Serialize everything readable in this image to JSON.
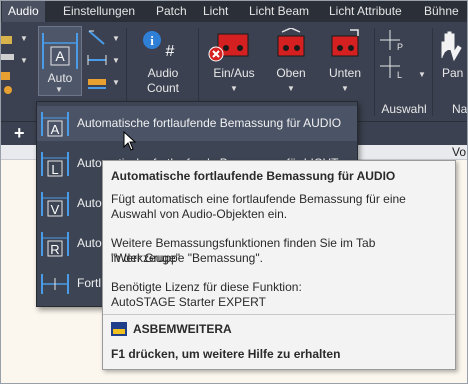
{
  "tabs": [
    "Audio",
    "Einstellungen",
    "Patch",
    "Licht",
    "Licht Beam",
    "Licht Attribute",
    "Bühne"
  ],
  "ribbon": {
    "auto_label": "Auto",
    "audio_count_label_1": "Audio",
    "audio_count_label_2": "Count",
    "ein_aus_label": "Ein/Aus",
    "oben_label": "Oben",
    "unten_label": "Unten",
    "auswahl_label": "Auswahl",
    "pan_label": "Pan",
    "extra_label": "Na"
  },
  "doc": {
    "plus": "+",
    "right_text": "Vo"
  },
  "dropdown": {
    "items": [
      {
        "letter": "A",
        "label": "Automatische fortlaufende Bemassung für AUDIO"
      },
      {
        "letter": "L",
        "label": "Automatische fortlaufende Bemassung für LICHT"
      },
      {
        "letter": "V",
        "label": "Auto"
      },
      {
        "letter": "R",
        "label": "Auto"
      },
      {
        "letter": "",
        "label": "Fortl"
      }
    ]
  },
  "tooltip": {
    "title": "Automatische fortlaufende Bemassung für AUDIO",
    "desc1": "Fügt automatisch eine fortlaufende Bemassung für eine",
    "desc2": "Auswahl von Audio-Objekten ein.",
    "more1": "Weitere Bemassungsfunktionen finden Sie im Tab \"Werkzeuge\"",
    "more2": "in der Gruppe \"Bemassung\".",
    "license1": "Benötigte Lizenz für diese Funktion:",
    "license2": "AutoSTAGE Starter EXPERT",
    "command": "ASBEMWEITERA",
    "help": "F1 drücken, um weitere Hilfe zu erhalten"
  },
  "colors": {
    "accent_red": "#e02020",
    "accent_blue": "#4a9be8"
  }
}
